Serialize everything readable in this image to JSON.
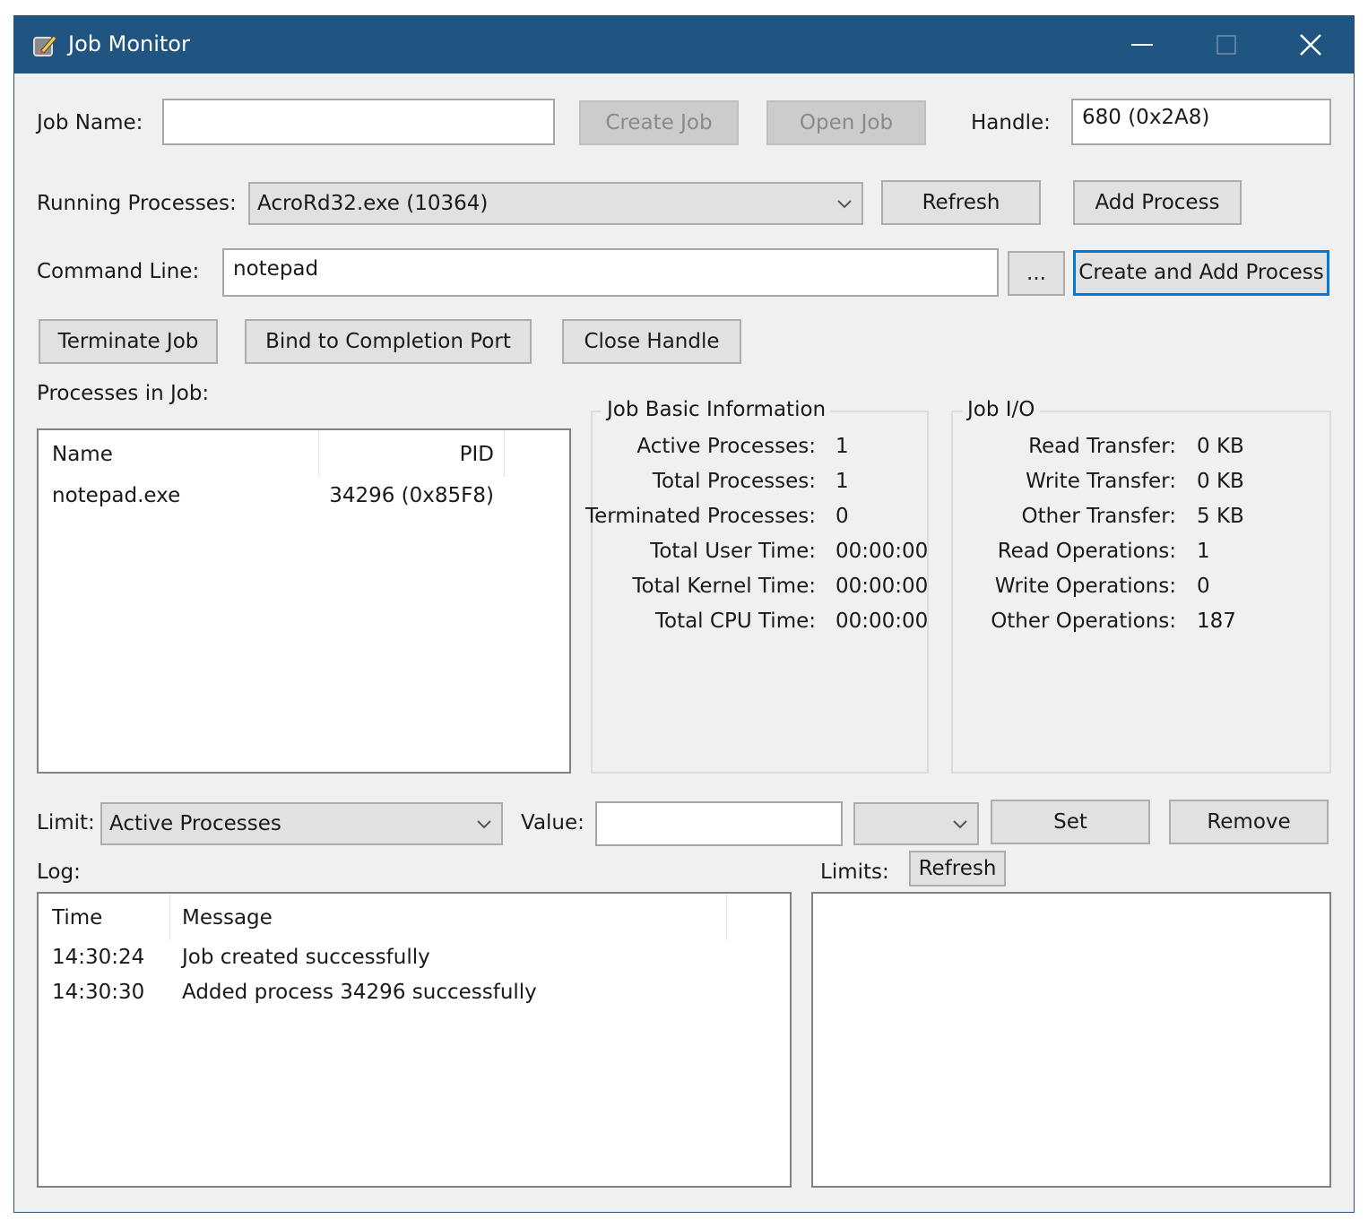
{
  "window": {
    "title": "Job Monitor",
    "icons": {
      "app": "app-icon",
      "minimize": "minimize-icon",
      "maximize": "maximize-icon",
      "close": "close-icon"
    }
  },
  "job": {
    "name_label": "Job Name:",
    "name_value": "",
    "create_label": "Create Job",
    "open_label": "Open Job",
    "handle_label": "Handle:",
    "handle_value": "680 (0x2A8)"
  },
  "processes": {
    "running_label": "Running Processes:",
    "running_selected": "AcroRd32.exe (10364)",
    "refresh_label": "Refresh",
    "add_label": "Add Process",
    "command_label": "Command Line:",
    "command_value": "notepad",
    "browse_label": "...",
    "create_add_label": "Create and Add Process"
  },
  "actions": {
    "terminate_label": "Terminate Job",
    "bind_label": "Bind to Completion Port",
    "close_handle_label": "Close Handle"
  },
  "process_list": {
    "label": "Processes in Job:",
    "columns": [
      "Name",
      "PID"
    ],
    "rows": [
      {
        "name": "notepad.exe",
        "pid": "34296 (0x85F8)"
      }
    ]
  },
  "basic_info": {
    "title": "Job Basic Information",
    "items": [
      {
        "key": "Active Processes:",
        "value": "1"
      },
      {
        "key": "Total Processes:",
        "value": "1"
      },
      {
        "key": "Terminated Processes:",
        "value": "0"
      },
      {
        "key": "Total User Time:",
        "value": "00:00:00"
      },
      {
        "key": "Total Kernel Time:",
        "value": "00:00:00"
      },
      {
        "key": "Total CPU Time:",
        "value": "00:00:00"
      }
    ]
  },
  "io_info": {
    "title": "Job I/O",
    "items": [
      {
        "key": "Read Transfer:",
        "value": "0 KB"
      },
      {
        "key": "Write Transfer:",
        "value": "0 KB"
      },
      {
        "key": "Other Transfer:",
        "value": "5 KB"
      },
      {
        "key": "Read Operations:",
        "value": "1"
      },
      {
        "key": "Write Operations:",
        "value": "0"
      },
      {
        "key": "Other Operations:",
        "value": "187"
      }
    ]
  },
  "limits_bar": {
    "limit_label": "Limit:",
    "limit_selected": "Active Processes",
    "value_label": "Value:",
    "value_input": "",
    "unit_selected": "",
    "set_label": "Set",
    "remove_label": "Remove"
  },
  "log": {
    "label": "Log:",
    "columns": [
      "Time",
      "Message"
    ],
    "rows": [
      {
        "time": "14:30:24",
        "message": "Job created successfully"
      },
      {
        "time": "14:30:30",
        "message": "Added process 34296 successfully"
      }
    ]
  },
  "limits_panel": {
    "label": "Limits:",
    "refresh_label": "Refresh"
  }
}
